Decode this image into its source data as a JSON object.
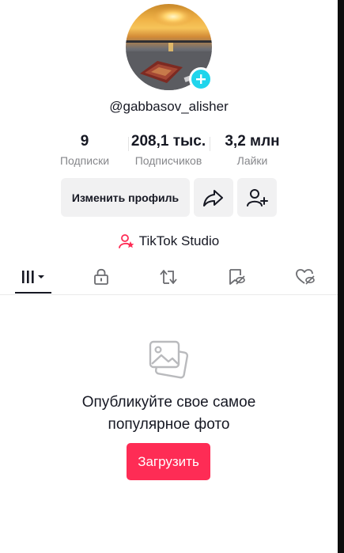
{
  "profile": {
    "username": "@gabbasov_alisher"
  },
  "stats": {
    "following": {
      "value": "9",
      "label": "Подписки"
    },
    "followers": {
      "value": "208,1 тыс.",
      "label": "Подписчиков"
    },
    "likes": {
      "value": "3,2 млн",
      "label": "Лайки"
    }
  },
  "actions": {
    "edit_label": "Изменить профиль"
  },
  "studio": {
    "label": "TikTok Studio"
  },
  "tabs": [
    {
      "name": "videos",
      "icon": "grid-icon",
      "active": true
    },
    {
      "name": "private",
      "icon": "lock-icon"
    },
    {
      "name": "reposts",
      "icon": "repost-icon"
    },
    {
      "name": "saved",
      "icon": "bookmark-icon"
    },
    {
      "name": "liked",
      "icon": "hidden-heart-icon"
    }
  ],
  "empty_state": {
    "title_line1": "Опубликуйте свое самое",
    "title_line2": "популярное фото",
    "upload_label": "Загрузить"
  },
  "colors": {
    "accent": "#fe2c55",
    "badge": "#20d5ec",
    "muted_text": "#86878b",
    "button_bg": "#f1f1f2"
  }
}
